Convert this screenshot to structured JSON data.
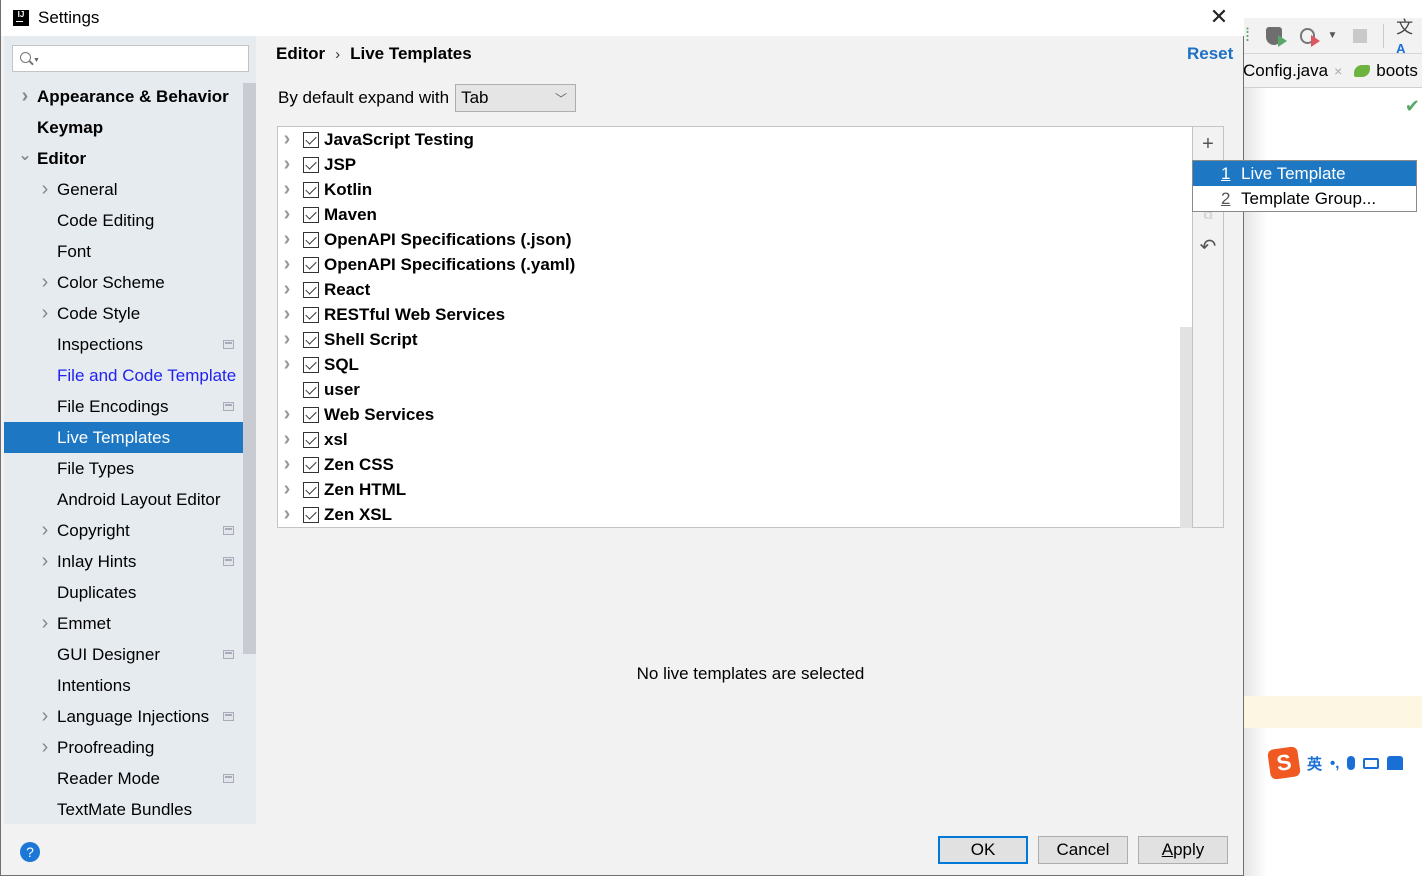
{
  "window": {
    "title": "Settings",
    "app_icon": "intellij-icon",
    "close_icon": "close-icon"
  },
  "background_ide": {
    "toolbar_icons": [
      "run-coverage-icon",
      "profile-icon",
      "dropdown-icon",
      "stop-icon",
      "translate-icon"
    ],
    "tabs": [
      {
        "label": "Config.java",
        "close": "×"
      },
      {
        "label": "boots",
        "icon": "spring-boot-icon"
      }
    ],
    "check_icon": "✔",
    "ime_bar": {
      "logo": "S",
      "items": [
        "英",
        "•,",
        "🎤",
        "⌨",
        "👕"
      ]
    }
  },
  "sidebar": {
    "search": {
      "placeholder": "",
      "value": ""
    },
    "items": [
      {
        "label": "Appearance & Behavior",
        "level": 0,
        "arrow": "right",
        "bold": true
      },
      {
        "label": "Keymap",
        "level": 0,
        "arrow": "",
        "bold": true
      },
      {
        "label": "Editor",
        "level": 0,
        "arrow": "down",
        "bold": true
      },
      {
        "label": "General",
        "level": 1,
        "arrow": "right"
      },
      {
        "label": "Code Editing",
        "level": 1,
        "arrow": ""
      },
      {
        "label": "Font",
        "level": 1,
        "arrow": ""
      },
      {
        "label": "Color Scheme",
        "level": 1,
        "arrow": "right"
      },
      {
        "label": "Code Style",
        "level": 1,
        "arrow": "right"
      },
      {
        "label": "Inspections",
        "level": 1,
        "arrow": "",
        "project_icon": true
      },
      {
        "label": "File and Code Template",
        "level": 1,
        "arrow": "",
        "link": true
      },
      {
        "label": "File Encodings",
        "level": 1,
        "arrow": "",
        "project_icon": true
      },
      {
        "label": "Live Templates",
        "level": 1,
        "arrow": "",
        "selected": true
      },
      {
        "label": "File Types",
        "level": 1,
        "arrow": ""
      },
      {
        "label": "Android Layout Editor",
        "level": 1,
        "arrow": ""
      },
      {
        "label": "Copyright",
        "level": 1,
        "arrow": "right",
        "project_icon": true
      },
      {
        "label": "Inlay Hints",
        "level": 1,
        "arrow": "right",
        "project_icon": true
      },
      {
        "label": "Duplicates",
        "level": 1,
        "arrow": ""
      },
      {
        "label": "Emmet",
        "level": 1,
        "arrow": "right"
      },
      {
        "label": "GUI Designer",
        "level": 1,
        "arrow": "",
        "project_icon": true
      },
      {
        "label": "Intentions",
        "level": 1,
        "arrow": ""
      },
      {
        "label": "Language Injections",
        "level": 1,
        "arrow": "right",
        "project_icon": true
      },
      {
        "label": "Proofreading",
        "level": 1,
        "arrow": "right"
      },
      {
        "label": "Reader Mode",
        "level": 1,
        "arrow": "",
        "project_icon": true
      },
      {
        "label": "TextMate Bundles",
        "level": 1,
        "arrow": ""
      }
    ]
  },
  "main": {
    "breadcrumb": {
      "parent": "Editor",
      "separator": "›",
      "current": "Live Templates"
    },
    "reset_label": "Reset",
    "expand": {
      "label": "By default expand with",
      "value": "Tab"
    },
    "templates": [
      {
        "name": "JavaScript Testing",
        "checked": true,
        "expandable": true
      },
      {
        "name": "JSP",
        "checked": true,
        "expandable": true
      },
      {
        "name": "Kotlin",
        "checked": true,
        "expandable": true
      },
      {
        "name": "Maven",
        "checked": true,
        "expandable": true
      },
      {
        "name": "OpenAPI Specifications (.json)",
        "checked": true,
        "expandable": true
      },
      {
        "name": "OpenAPI Specifications (.yaml)",
        "checked": true,
        "expandable": true
      },
      {
        "name": "React",
        "checked": true,
        "expandable": true
      },
      {
        "name": "RESTful Web Services",
        "checked": true,
        "expandable": true
      },
      {
        "name": "Shell Script",
        "checked": true,
        "expandable": true
      },
      {
        "name": "SQL",
        "checked": true,
        "expandable": true
      },
      {
        "name": "user",
        "checked": true,
        "expandable": false
      },
      {
        "name": "Web Services",
        "checked": true,
        "expandable": true
      },
      {
        "name": "xsl",
        "checked": true,
        "expandable": true
      },
      {
        "name": "Zen CSS",
        "checked": true,
        "expandable": true
      },
      {
        "name": "Zen HTML",
        "checked": true,
        "expandable": true
      },
      {
        "name": "Zen XSL",
        "checked": true,
        "expandable": true
      }
    ],
    "toolbar": {
      "add": "+",
      "copy": "⧉",
      "restore": "↶"
    },
    "add_popup": [
      {
        "mnemonic": "1",
        "label": "Live Template",
        "selected": true
      },
      {
        "mnemonic": "2",
        "label": "Template Group...",
        "selected": false
      }
    ],
    "empty_message": "No live templates are selected"
  },
  "footer": {
    "help": "?",
    "ok_label": "OK",
    "cancel_label": "Cancel",
    "apply_mnemonic": "A",
    "apply_rest": "pply"
  }
}
